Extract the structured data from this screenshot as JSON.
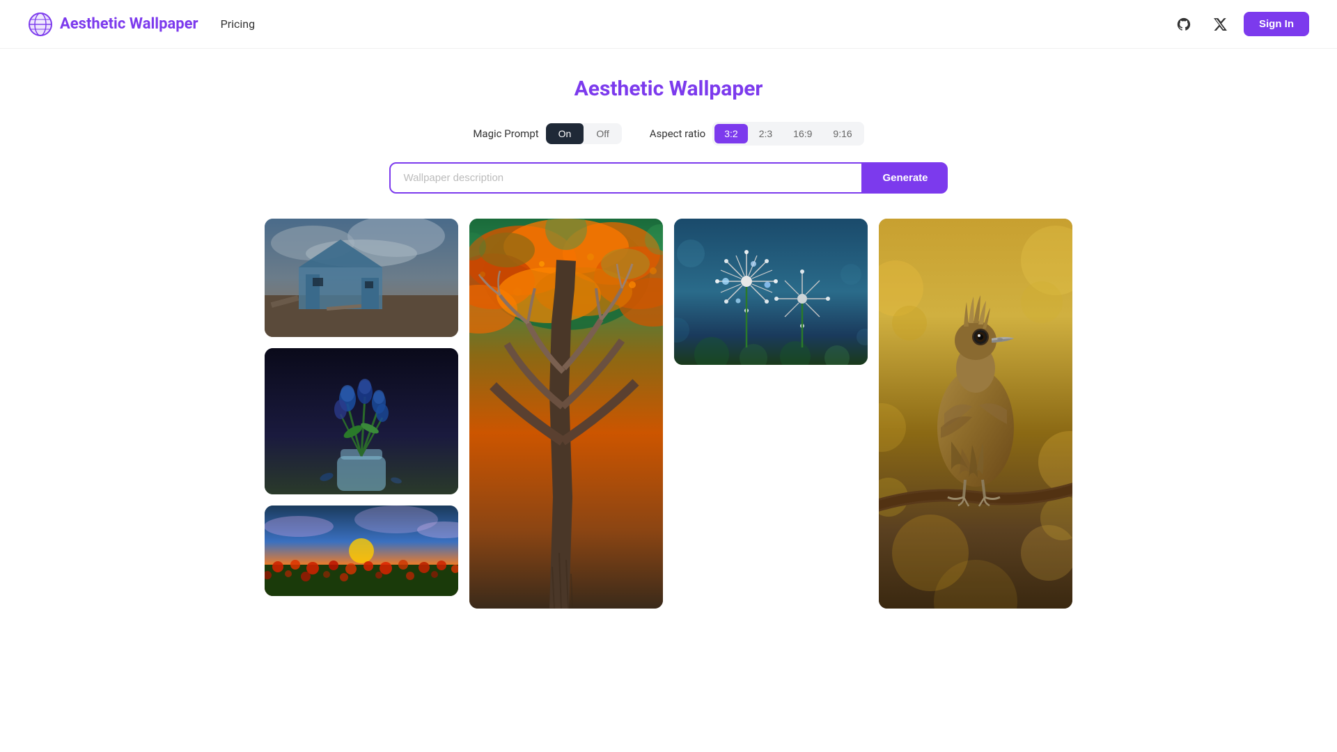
{
  "header": {
    "logo_text": "Aesthetic Wallpaper",
    "nav": [
      {
        "label": "Pricing"
      }
    ],
    "github_icon": "github-icon",
    "x_icon": "x-icon",
    "sign_in_label": "Sign In"
  },
  "page": {
    "title": "Aesthetic Wallpaper"
  },
  "controls": {
    "magic_prompt_label": "Magic Prompt",
    "on_label": "On",
    "off_label": "Off",
    "aspect_ratio_label": "Aspect ratio",
    "aspect_options": [
      "3:2",
      "2:3",
      "16:9",
      "9:16"
    ],
    "active_aspect": "3:2",
    "active_toggle": "On"
  },
  "search": {
    "placeholder": "Wallpaper description",
    "generate_label": "Generate"
  },
  "gallery": {
    "images": [
      {
        "id": "ruined-house",
        "alt": "Ruined blue house in storm"
      },
      {
        "id": "blue-tulips",
        "alt": "Blue tulips in glass vase"
      },
      {
        "id": "sunset-poppies",
        "alt": "Sunset over poppy field"
      },
      {
        "id": "autumn-tree",
        "alt": "Autumn tree from below"
      },
      {
        "id": "dandelion",
        "alt": "Dandelion with water drops"
      },
      {
        "id": "bird",
        "alt": "Detailed bird on branch with golden bokeh"
      }
    ]
  }
}
